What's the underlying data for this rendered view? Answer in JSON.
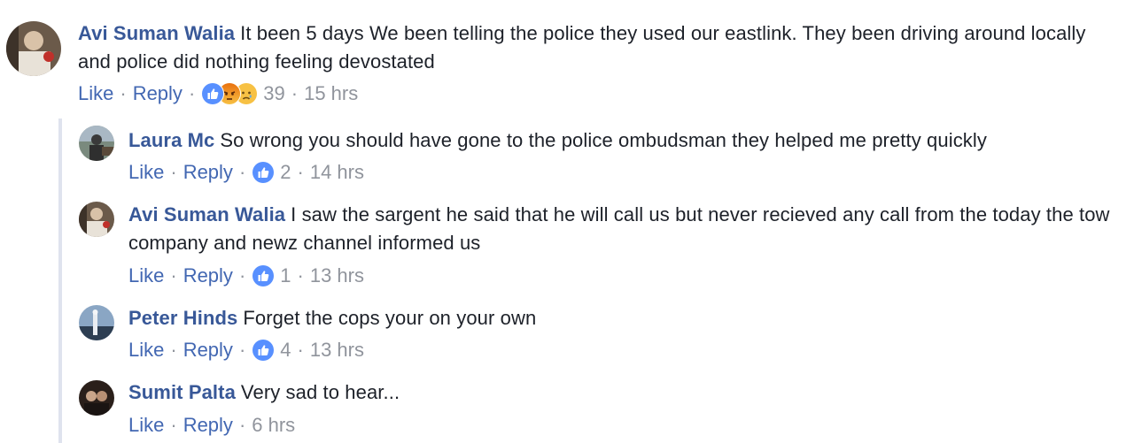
{
  "comments": [
    {
      "author": "Avi Suman Walia",
      "text": "It been 5 days We been telling the police they used our eastlink. They been driving around locally and police did nothing feeling devostated",
      "like_label": "Like",
      "reply_label": "Reply",
      "reaction_icons": [
        "like-icon",
        "angry-icon",
        "sad-icon"
      ],
      "reaction_count": "39",
      "time": "15 hrs"
    },
    {
      "author": "Laura Mc",
      "text": "So wrong you should have gone to the police ombudsman they helped me pretty quickly",
      "like_label": "Like",
      "reply_label": "Reply",
      "reaction_icons": [
        "like-icon"
      ],
      "reaction_count": "2",
      "time": "14 hrs"
    },
    {
      "author": "Avi Suman Walia",
      "text": "I saw the sargent he said that he will call us but never recieved any call from the today the tow company and newz channel informed us",
      "like_label": "Like",
      "reply_label": "Reply",
      "reaction_icons": [
        "like-icon"
      ],
      "reaction_count": "1",
      "time": "13 hrs"
    },
    {
      "author": "Peter Hinds",
      "text": "Forget the cops your on your own",
      "like_label": "Like",
      "reply_label": "Reply",
      "reaction_icons": [
        "like-icon"
      ],
      "reaction_count": "4",
      "time": "13 hrs"
    },
    {
      "author": "Sumit Palta",
      "text": "Very sad to hear...",
      "like_label": "Like",
      "reply_label": "Reply",
      "reaction_icons": [],
      "reaction_count": "",
      "time": "6 hrs"
    }
  ],
  "colors": {
    "author": "#385898",
    "link": "#4267b2",
    "meta": "#90949c",
    "like_blue": "#5890ff",
    "angry": "#e9710f",
    "sad": "#f7c144",
    "thread_line": "#dfe3ee"
  }
}
